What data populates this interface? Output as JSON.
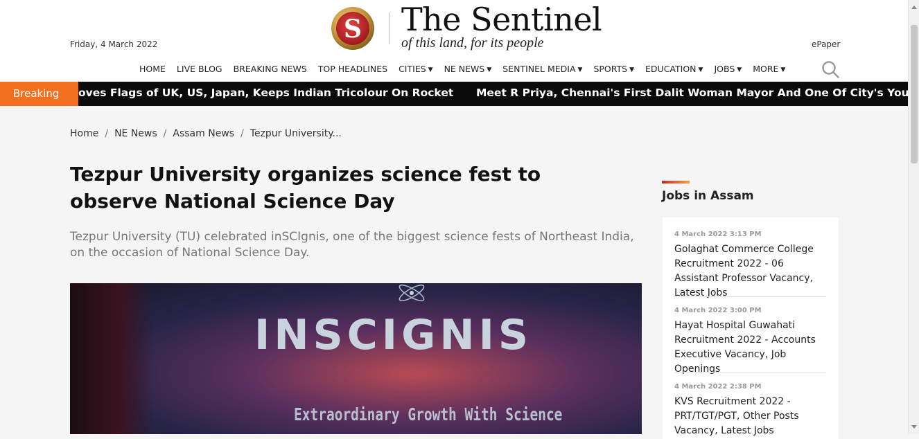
{
  "header": {
    "date": "Friday, 4 March 2022",
    "brand_title": "The Sentinel",
    "brand_tagline": "of this land, for its people",
    "epaper": "ePaper",
    "logo_letter": "S"
  },
  "nav": [
    {
      "label": "HOME",
      "dropdown": false
    },
    {
      "label": "LIVE BLOG",
      "dropdown": false
    },
    {
      "label": "BREAKING NEWS",
      "dropdown": false
    },
    {
      "label": "TOP HEADLINES",
      "dropdown": false
    },
    {
      "label": "CITIES",
      "dropdown": true
    },
    {
      "label": "NE NEWS",
      "dropdown": true
    },
    {
      "label": "SENTINEL MEDIA",
      "dropdown": true
    },
    {
      "label": "SPORTS",
      "dropdown": true
    },
    {
      "label": "EDUCATION",
      "dropdown": true
    },
    {
      "label": "JOBS",
      "dropdown": true
    },
    {
      "label": "MORE",
      "dropdown": true
    }
  ],
  "ticker": {
    "label": "Breaking",
    "items": [
      "oves Flags of UK, US, Japan, Keeps Indian Tricolour On Rocket",
      "Meet R Priya, Chennai's First Dalit Woman Mayor And One Of City's Young"
    ]
  },
  "breadcrumb": [
    "Home",
    "NE News",
    "Assam News",
    "Tezpur University..."
  ],
  "article": {
    "headline": "Tezpur University organizes science fest to observe National Science Day",
    "summary": "Tezpur University (TU) celebrated inSCIgnis, one of the biggest science fests of Northeast India, on the occasion of National Science Day.",
    "image_title": "INSCIGNIS",
    "image_subtitle": "Extraordinary Growth With Science"
  },
  "sidebar": {
    "title": "Jobs in Assam",
    "jobs": [
      {
        "time": "4 March 2022 3:13 PM",
        "title": "Golaghat Commerce College Recruitment 2022 - 06 Assistant Professor Vacancy, Latest Jobs"
      },
      {
        "time": "4 March 2022 3:00 PM",
        "title": "Hayat Hospital Guwahati Recruitment 2022 - Accounts Executive Vacancy, Job Openings"
      },
      {
        "time": "4 March 2022 2:38 PM",
        "title": "KVS Recruitment 2022 - PRT/TGT/PGT, Other Posts Vacancy, Latest Jobs"
      }
    ]
  },
  "colors": {
    "accent_orange": "#f37021",
    "ticker_bg": "#0b0b0b",
    "logo_red": "#c8282c",
    "logo_gold": "#d7a54a"
  },
  "icons": [
    "logo-emblem-icon",
    "search-icon",
    "dropdown-caret-icon",
    "atom-icon"
  ]
}
